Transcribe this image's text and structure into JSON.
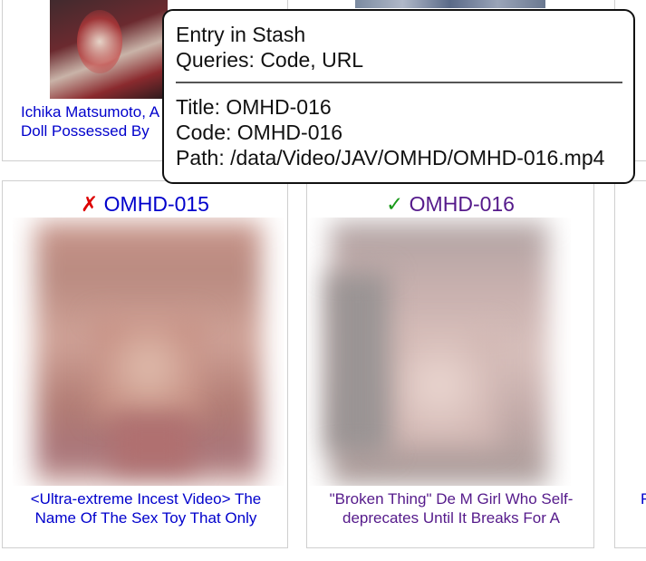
{
  "cards": {
    "top_left": {
      "caption_line1": "Ichika Matsumoto, A",
      "caption_line2": "Doll Possessed By"
    },
    "left": {
      "status_mark": "✗",
      "status_color": "#dd0000",
      "code": "OMHD-015",
      "code_color": "#0000cc",
      "caption_line1": "<Ultra-extreme Incest Video> The",
      "caption_line2": "Name Of The Sex Toy That Only",
      "caption_color": "#0000cc"
    },
    "middle": {
      "status_mark": "✓",
      "status_color": "#1a9a1a",
      "code": "OMHD-016",
      "code_color": "#551a8b",
      "caption_line1": "\"Broken Thing\" De M Girl Who Self-",
      "caption_line2": "deprecates Until It Breaks For A",
      "caption_color": "#551a8b"
    },
    "right_partial": {
      "caption_fragment": "F"
    }
  },
  "tooltip": {
    "heading": "Entry in Stash",
    "queries": "Queries: Code, URL",
    "title": "Title: OMHD-016",
    "code": "Code: OMHD-016",
    "path": "Path: /data/Video/JAV/OMHD/OMHD-016.mp4"
  }
}
